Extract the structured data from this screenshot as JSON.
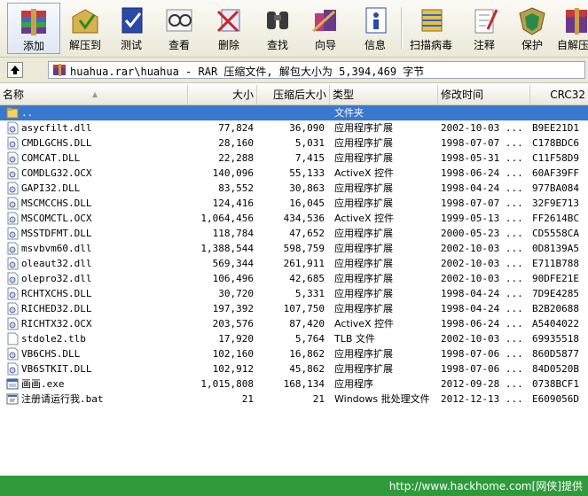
{
  "toolbar": {
    "buttons": [
      {
        "label": "添加",
        "icon": "add-archive-icon"
      },
      {
        "label": "解压到",
        "icon": "extract-to-icon"
      },
      {
        "label": "测试",
        "icon": "test-icon"
      },
      {
        "label": "查看",
        "icon": "view-icon"
      },
      {
        "label": "删除",
        "icon": "delete-icon"
      },
      {
        "label": "查找",
        "icon": "find-icon"
      },
      {
        "label": "向导",
        "icon": "wizard-icon"
      },
      {
        "label": "信息",
        "icon": "info-icon"
      },
      {
        "label": "扫描病毒",
        "icon": "virus-scan-icon"
      },
      {
        "label": "注释",
        "icon": "comment-icon"
      },
      {
        "label": "保护",
        "icon": "protect-icon"
      },
      {
        "label": "自解压",
        "icon": "sfx-icon"
      }
    ]
  },
  "address": {
    "text": "huahua.rar\\huahua - RAR 压缩文件, 解包大小为 5,394,469 字节"
  },
  "columns": {
    "name": "名称",
    "size": "大小",
    "packed": "压缩后大小",
    "type": "类型",
    "modified": "修改时间",
    "crc": "CRC32"
  },
  "files": [
    {
      "name": "..",
      "size": "",
      "packed": "",
      "type": "文件夹",
      "modified": "",
      "crc": "",
      "kind": "folder"
    },
    {
      "name": "asycfilt.dll",
      "size": "77,824",
      "packed": "36,090",
      "type": "应用程序扩展",
      "modified": "2002-10-03 ...",
      "crc": "B9EE21D1",
      "kind": "dll"
    },
    {
      "name": "CMDLGCHS.DLL",
      "size": "28,160",
      "packed": "5,031",
      "type": "应用程序扩展",
      "modified": "1998-07-07 ...",
      "crc": "C178BDC6",
      "kind": "dll"
    },
    {
      "name": "COMCAT.DLL",
      "size": "22,288",
      "packed": "7,415",
      "type": "应用程序扩展",
      "modified": "1998-05-31 ...",
      "crc": "C11F58D9",
      "kind": "dll"
    },
    {
      "name": "COMDLG32.OCX",
      "size": "140,096",
      "packed": "55,133",
      "type": "ActiveX 控件",
      "modified": "1998-06-24 ...",
      "crc": "60AF39FF",
      "kind": "dll"
    },
    {
      "name": "GAPI32.DLL",
      "size": "83,552",
      "packed": "30,863",
      "type": "应用程序扩展",
      "modified": "1998-04-24 ...",
      "crc": "977BA084",
      "kind": "dll"
    },
    {
      "name": "MSCMCCHS.DLL",
      "size": "124,416",
      "packed": "16,045",
      "type": "应用程序扩展",
      "modified": "1998-07-07 ...",
      "crc": "32F9E713",
      "kind": "dll"
    },
    {
      "name": "MSCOMCTL.OCX",
      "size": "1,064,456",
      "packed": "434,536",
      "type": "ActiveX 控件",
      "modified": "1999-05-13 ...",
      "crc": "FF2614BC",
      "kind": "dll"
    },
    {
      "name": "MSSTDFMT.DLL",
      "size": "118,784",
      "packed": "47,652",
      "type": "应用程序扩展",
      "modified": "2000-05-23 ...",
      "crc": "CD5558CA",
      "kind": "dll"
    },
    {
      "name": "msvbvm60.dll",
      "size": "1,388,544",
      "packed": "598,759",
      "type": "应用程序扩展",
      "modified": "2002-10-03 ...",
      "crc": "0D8139A5",
      "kind": "dll"
    },
    {
      "name": "oleaut32.dll",
      "size": "569,344",
      "packed": "261,911",
      "type": "应用程序扩展",
      "modified": "2002-10-03 ...",
      "crc": "E711B788",
      "kind": "dll"
    },
    {
      "name": "olepro32.dll",
      "size": "106,496",
      "packed": "42,685",
      "type": "应用程序扩展",
      "modified": "2002-10-03 ...",
      "crc": "90DFE21E",
      "kind": "dll"
    },
    {
      "name": "RCHTXCHS.DLL",
      "size": "30,720",
      "packed": "5,331",
      "type": "应用程序扩展",
      "modified": "1998-04-24 ...",
      "crc": "7D9E4285",
      "kind": "dll"
    },
    {
      "name": "RICHED32.DLL",
      "size": "197,392",
      "packed": "107,750",
      "type": "应用程序扩展",
      "modified": "1998-04-24 ...",
      "crc": "B2B20688",
      "kind": "dll"
    },
    {
      "name": "RICHTX32.OCX",
      "size": "203,576",
      "packed": "87,420",
      "type": "ActiveX 控件",
      "modified": "1998-06-24 ...",
      "crc": "A5404022",
      "kind": "dll"
    },
    {
      "name": "stdole2.tlb",
      "size": "17,920",
      "packed": "5,764",
      "type": "TLB 文件",
      "modified": "2002-10-03 ...",
      "crc": "69935518",
      "kind": "tlb"
    },
    {
      "name": "VB6CHS.DLL",
      "size": "102,160",
      "packed": "16,862",
      "type": "应用程序扩展",
      "modified": "1998-07-06 ...",
      "crc": "860D5877",
      "kind": "dll"
    },
    {
      "name": "VB6STKIT.DLL",
      "size": "102,912",
      "packed": "45,862",
      "type": "应用程序扩展",
      "modified": "1998-07-06 ...",
      "crc": "84D0520B",
      "kind": "dll"
    },
    {
      "name": "画画.exe",
      "size": "1,015,808",
      "packed": "168,134",
      "type": "应用程序",
      "modified": "2012-09-28 ...",
      "crc": "0738BCF1",
      "kind": "exe"
    },
    {
      "name": "注册请运行我.bat",
      "size": "21",
      "packed": "21",
      "type": "Windows 批处理文件",
      "modified": "2012-12-13 ...",
      "crc": "E609056D",
      "kind": "bat"
    }
  ],
  "status": {
    "text": "http://www.hackhome.com[网侠]提供"
  }
}
